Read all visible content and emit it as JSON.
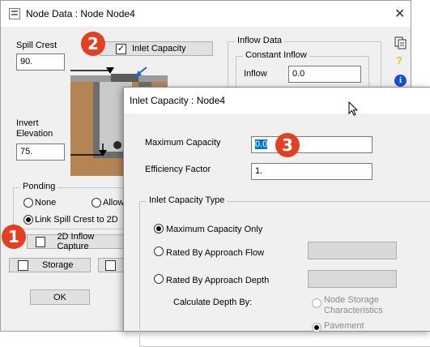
{
  "node_window": {
    "title": "Node Data : Node Node4",
    "spill_crest": {
      "label": "Spill Crest",
      "value": "90."
    },
    "inlet_capacity_checkbox": {
      "label": "Inlet Capacity",
      "checked": true
    },
    "invert_elevation": {
      "label_line1": "Invert",
      "label_line2": "Elevation",
      "value": "75."
    },
    "ponding": {
      "title": "Ponding",
      "option_none": "None",
      "option_allow": "Allow",
      "option_link": "Link Spill Crest to 2D",
      "selected": "Link Spill Crest to 2D"
    },
    "inflow_capture": {
      "label": "2D Inflow Capture",
      "checked": false
    },
    "storage": {
      "label": "Storage",
      "checked": false
    },
    "ok_label": "OK",
    "inflow_data": {
      "title": "Inflow Data",
      "constant_inflow_title": "Constant Inflow",
      "inflow_label": "Inflow",
      "inflow_value": "0.0"
    },
    "side_icons": [
      "copy-icon",
      "help-icon",
      "info-icon"
    ]
  },
  "inlet_window": {
    "title": "Inlet Capacity : Node4",
    "maximum_capacity": {
      "label": "Maximum Capacity",
      "value": "0.0"
    },
    "efficiency_factor": {
      "label": "Efficiency Factor",
      "value": "1."
    },
    "inlet_capacity_type": {
      "title": "Inlet Capacity Type",
      "options": [
        "Maximum Capacity Only",
        "Rated By Approach Flow",
        "Rated By Approach Depth"
      ],
      "selected": "Maximum Capacity Only"
    },
    "calculate_depth_by": {
      "label": "Calculate Depth By:",
      "option_node_storage_line1": "Node Storage",
      "option_node_storage_line2": "Characteristics",
      "option_pavement": "Pavement"
    }
  },
  "annotations": {
    "badge1": "1",
    "badge2": "2",
    "badge3": "3"
  },
  "colors": {
    "badge": "#e33f22",
    "selection": "#0078d7",
    "info_icon": "#1a4fd1",
    "help_icon": "#e8c800"
  }
}
